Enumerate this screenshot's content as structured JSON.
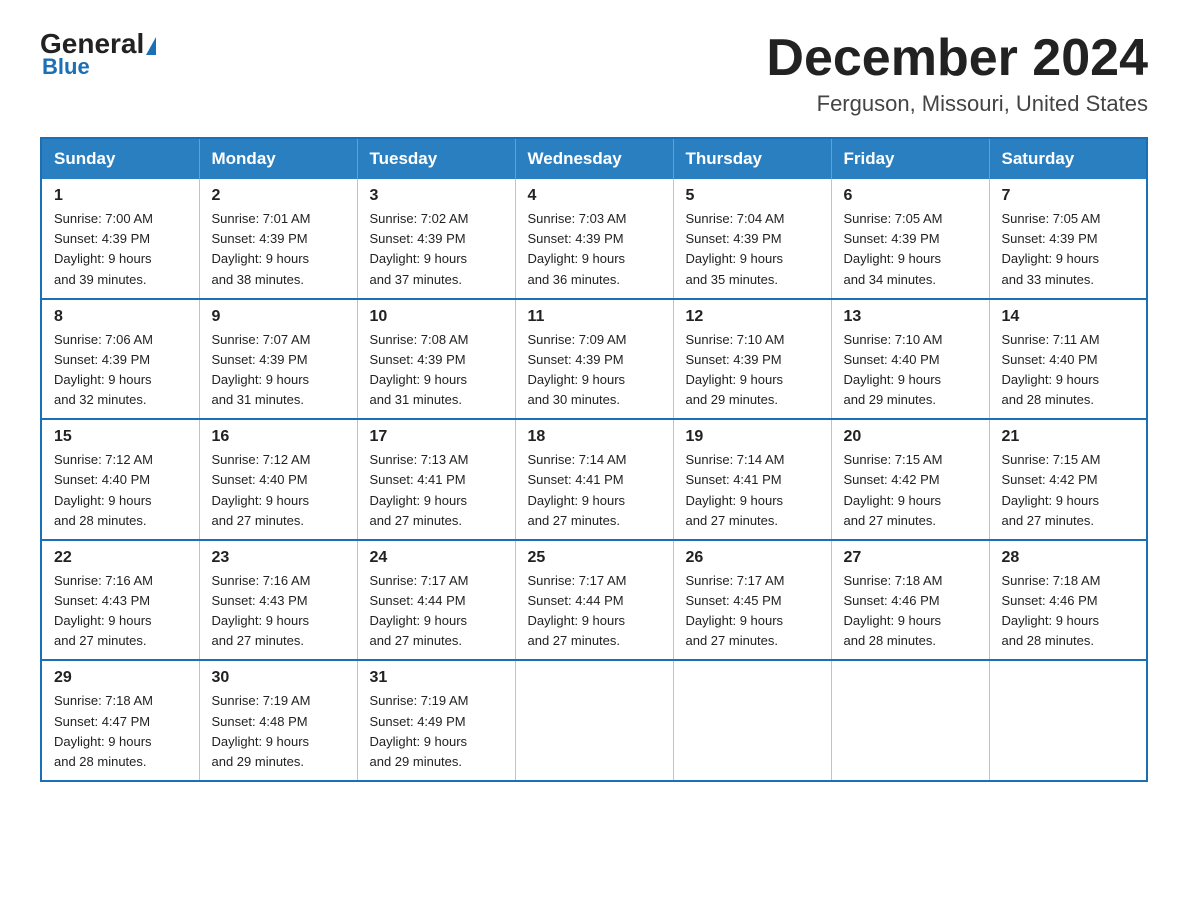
{
  "header": {
    "logo_general": "General",
    "logo_blue": "Blue",
    "month_year": "December 2024",
    "location": "Ferguson, Missouri, United States"
  },
  "weekdays": [
    "Sunday",
    "Monday",
    "Tuesday",
    "Wednesday",
    "Thursday",
    "Friday",
    "Saturday"
  ],
  "weeks": [
    [
      {
        "day": "1",
        "sunrise": "7:00 AM",
        "sunset": "4:39 PM",
        "daylight": "9 hours and 39 minutes."
      },
      {
        "day": "2",
        "sunrise": "7:01 AM",
        "sunset": "4:39 PM",
        "daylight": "9 hours and 38 minutes."
      },
      {
        "day": "3",
        "sunrise": "7:02 AM",
        "sunset": "4:39 PM",
        "daylight": "9 hours and 37 minutes."
      },
      {
        "day": "4",
        "sunrise": "7:03 AM",
        "sunset": "4:39 PM",
        "daylight": "9 hours and 36 minutes."
      },
      {
        "day": "5",
        "sunrise": "7:04 AM",
        "sunset": "4:39 PM",
        "daylight": "9 hours and 35 minutes."
      },
      {
        "day": "6",
        "sunrise": "7:05 AM",
        "sunset": "4:39 PM",
        "daylight": "9 hours and 34 minutes."
      },
      {
        "day": "7",
        "sunrise": "7:05 AM",
        "sunset": "4:39 PM",
        "daylight": "9 hours and 33 minutes."
      }
    ],
    [
      {
        "day": "8",
        "sunrise": "7:06 AM",
        "sunset": "4:39 PM",
        "daylight": "9 hours and 32 minutes."
      },
      {
        "day": "9",
        "sunrise": "7:07 AM",
        "sunset": "4:39 PM",
        "daylight": "9 hours and 31 minutes."
      },
      {
        "day": "10",
        "sunrise": "7:08 AM",
        "sunset": "4:39 PM",
        "daylight": "9 hours and 31 minutes."
      },
      {
        "day": "11",
        "sunrise": "7:09 AM",
        "sunset": "4:39 PM",
        "daylight": "9 hours and 30 minutes."
      },
      {
        "day": "12",
        "sunrise": "7:10 AM",
        "sunset": "4:39 PM",
        "daylight": "9 hours and 29 minutes."
      },
      {
        "day": "13",
        "sunrise": "7:10 AM",
        "sunset": "4:40 PM",
        "daylight": "9 hours and 29 minutes."
      },
      {
        "day": "14",
        "sunrise": "7:11 AM",
        "sunset": "4:40 PM",
        "daylight": "9 hours and 28 minutes."
      }
    ],
    [
      {
        "day": "15",
        "sunrise": "7:12 AM",
        "sunset": "4:40 PM",
        "daylight": "9 hours and 28 minutes."
      },
      {
        "day": "16",
        "sunrise": "7:12 AM",
        "sunset": "4:40 PM",
        "daylight": "9 hours and 27 minutes."
      },
      {
        "day": "17",
        "sunrise": "7:13 AM",
        "sunset": "4:41 PM",
        "daylight": "9 hours and 27 minutes."
      },
      {
        "day": "18",
        "sunrise": "7:14 AM",
        "sunset": "4:41 PM",
        "daylight": "9 hours and 27 minutes."
      },
      {
        "day": "19",
        "sunrise": "7:14 AM",
        "sunset": "4:41 PM",
        "daylight": "9 hours and 27 minutes."
      },
      {
        "day": "20",
        "sunrise": "7:15 AM",
        "sunset": "4:42 PM",
        "daylight": "9 hours and 27 minutes."
      },
      {
        "day": "21",
        "sunrise": "7:15 AM",
        "sunset": "4:42 PM",
        "daylight": "9 hours and 27 minutes."
      }
    ],
    [
      {
        "day": "22",
        "sunrise": "7:16 AM",
        "sunset": "4:43 PM",
        "daylight": "9 hours and 27 minutes."
      },
      {
        "day": "23",
        "sunrise": "7:16 AM",
        "sunset": "4:43 PM",
        "daylight": "9 hours and 27 minutes."
      },
      {
        "day": "24",
        "sunrise": "7:17 AM",
        "sunset": "4:44 PM",
        "daylight": "9 hours and 27 minutes."
      },
      {
        "day": "25",
        "sunrise": "7:17 AM",
        "sunset": "4:44 PM",
        "daylight": "9 hours and 27 minutes."
      },
      {
        "day": "26",
        "sunrise": "7:17 AM",
        "sunset": "4:45 PM",
        "daylight": "9 hours and 27 minutes."
      },
      {
        "day": "27",
        "sunrise": "7:18 AM",
        "sunset": "4:46 PM",
        "daylight": "9 hours and 28 minutes."
      },
      {
        "day": "28",
        "sunrise": "7:18 AM",
        "sunset": "4:46 PM",
        "daylight": "9 hours and 28 minutes."
      }
    ],
    [
      {
        "day": "29",
        "sunrise": "7:18 AM",
        "sunset": "4:47 PM",
        "daylight": "9 hours and 28 minutes."
      },
      {
        "day": "30",
        "sunrise": "7:19 AM",
        "sunset": "4:48 PM",
        "daylight": "9 hours and 29 minutes."
      },
      {
        "day": "31",
        "sunrise": "7:19 AM",
        "sunset": "4:49 PM",
        "daylight": "9 hours and 29 minutes."
      },
      null,
      null,
      null,
      null
    ]
  ],
  "labels": {
    "sunrise_prefix": "Sunrise: ",
    "sunset_prefix": "Sunset: ",
    "daylight_prefix": "Daylight: "
  }
}
